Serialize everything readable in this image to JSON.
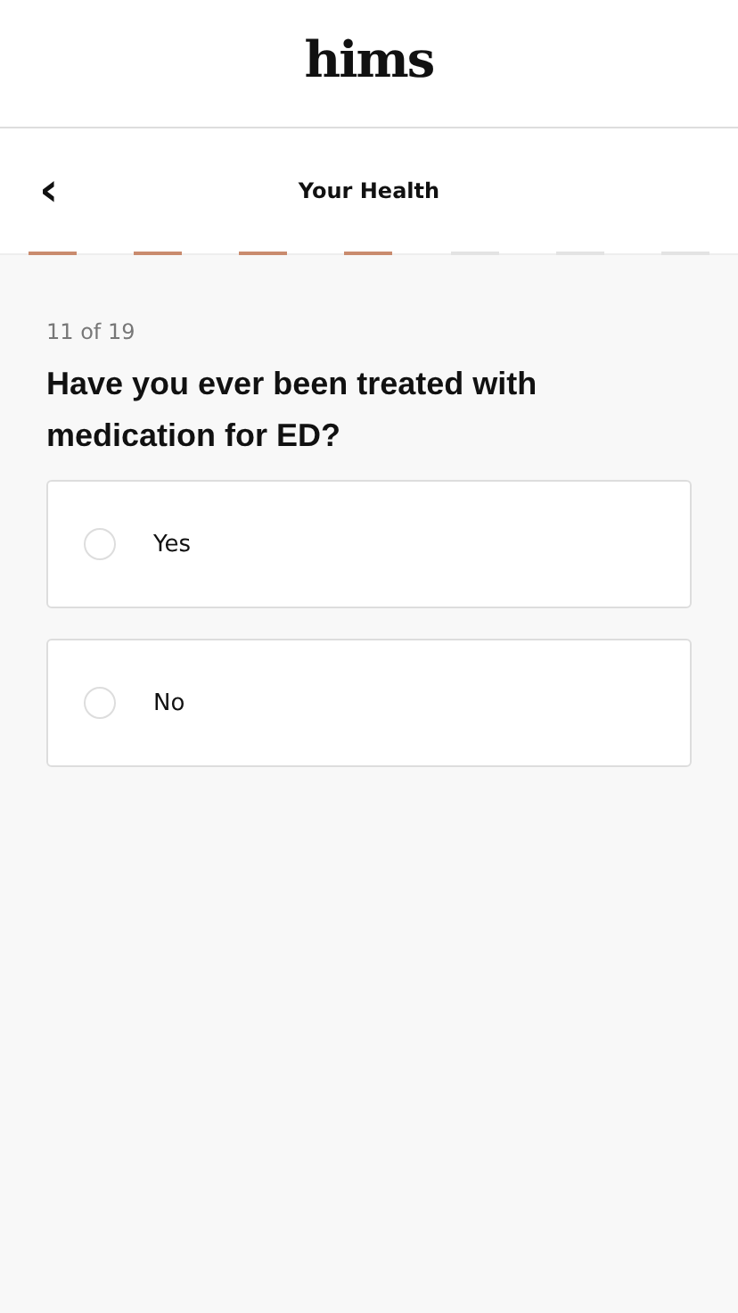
{
  "header": {
    "logo": "hims"
  },
  "nav": {
    "back": "‹",
    "title": "Your Health"
  },
  "progress": [
    {
      "completed": true
    },
    {
      "completed": true
    },
    {
      "completed": true
    },
    {
      "completed": true
    },
    {
      "completed": false
    },
    {
      "completed": false
    },
    {
      "completed": false
    }
  ],
  "question": {
    "counter": "11 of 19",
    "text": "Have you ever been treated with medication for ED?"
  },
  "options": [
    {
      "label": "Yes",
      "selected": false
    },
    {
      "label": "No",
      "selected": false
    }
  ]
}
